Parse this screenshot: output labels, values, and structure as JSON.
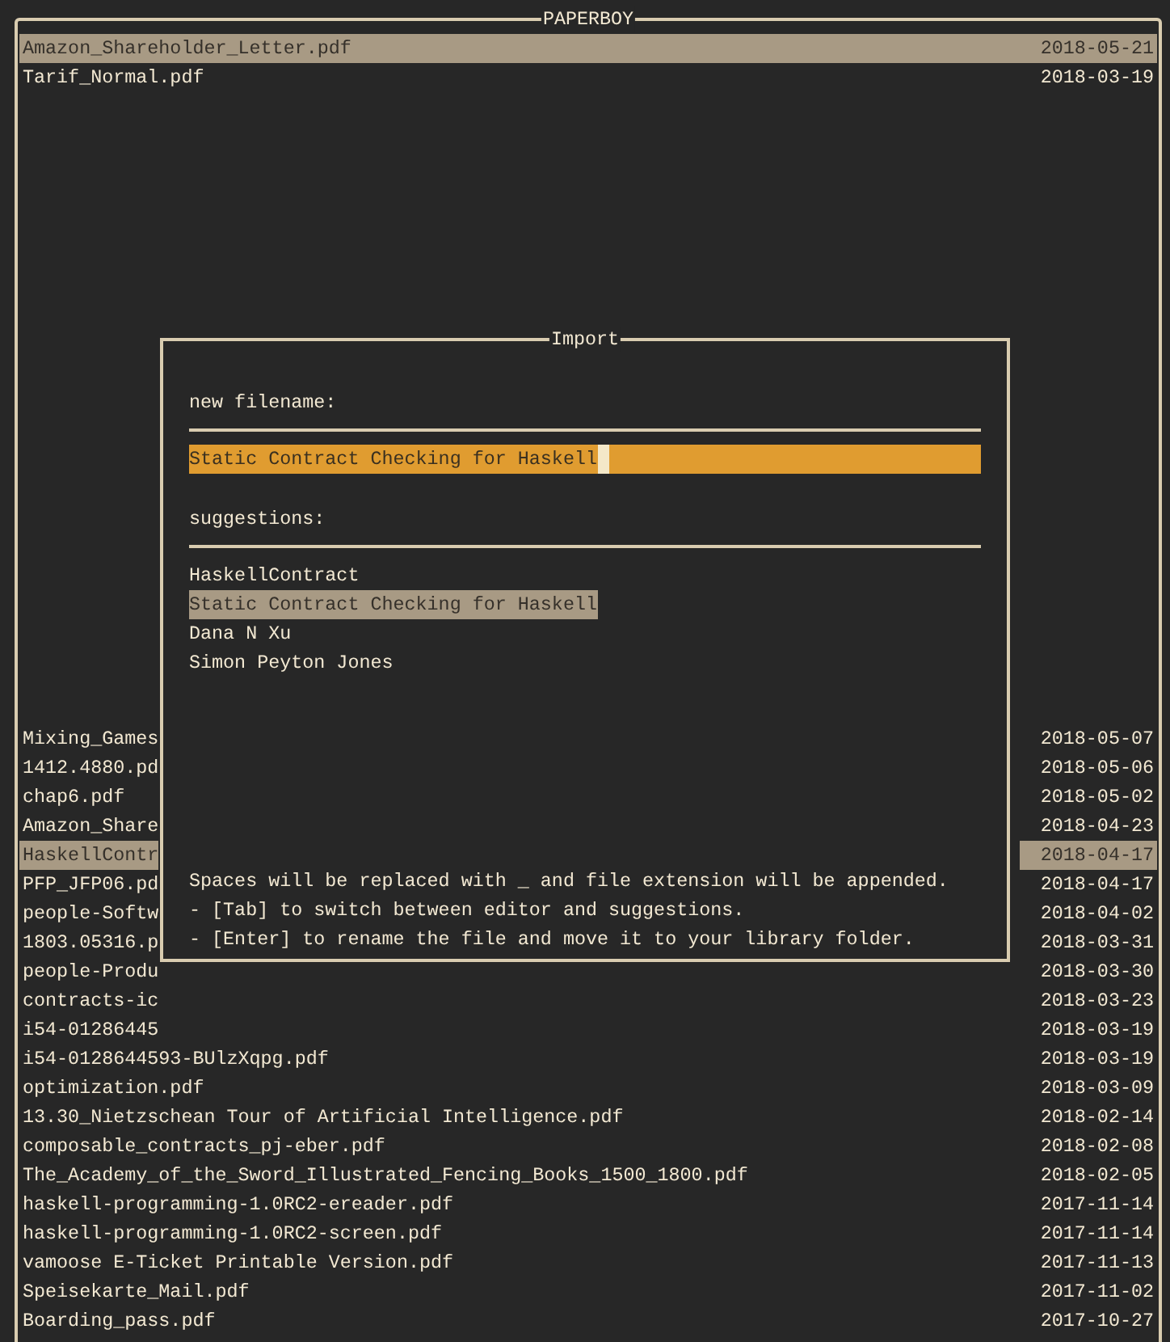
{
  "app": {
    "title": "PAPERBOY"
  },
  "files_top": [
    {
      "name": "Amazon_Shareholder_Letter.pdf",
      "date": "2018-05-21",
      "selected": true
    },
    {
      "name": "Tarif_Normal.pdf",
      "date": "2018-03-19",
      "selected": false
    }
  ],
  "files_bottom": [
    {
      "name": "Mixing_Games",
      "date": "2018-05-07",
      "selected": false
    },
    {
      "name": "1412.4880.pd",
      "date": "2018-05-06",
      "selected": false
    },
    {
      "name": "chap6.pdf",
      "date": "2018-05-02",
      "selected": false
    },
    {
      "name": "Amazon_Share",
      "date": "2018-04-23",
      "selected": false
    },
    {
      "name": "HaskellContr",
      "date": "2018-04-17",
      "selected": true
    },
    {
      "name": "PFP_JFP06.pd",
      "date": "2018-04-17",
      "selected": false
    },
    {
      "name": "people-Softw",
      "date": "2018-04-02",
      "selected": false
    },
    {
      "name": "1803.05316.p",
      "date": "2018-03-31",
      "selected": false
    },
    {
      "name": "people-Produ",
      "date": "2018-03-30",
      "selected": false
    },
    {
      "name": "contracts-ic",
      "date": "2018-03-23",
      "selected": false
    },
    {
      "name": "i54-01286445",
      "date": "2018-03-19",
      "selected": false
    },
    {
      "name": "i54-0128644593-BUlzXqpg.pdf",
      "date": "2018-03-19",
      "selected": false
    },
    {
      "name": "optimization.pdf",
      "date": "2018-03-09",
      "selected": false
    },
    {
      "name": "13.30_Nietzschean Tour of Artificial Intelligence.pdf",
      "date": "2018-02-14",
      "selected": false
    },
    {
      "name": "composable_contracts_pj-eber.pdf",
      "date": "2018-02-08",
      "selected": false
    },
    {
      "name": "The_Academy_of_the_Sword_Illustrated_Fencing_Books_1500_1800.pdf",
      "date": "2018-02-05",
      "selected": false
    },
    {
      "name": "haskell-programming-1.0RC2-ereader.pdf",
      "date": "2017-11-14",
      "selected": false
    },
    {
      "name": "haskell-programming-1.0RC2-screen.pdf",
      "date": "2017-11-14",
      "selected": false
    },
    {
      "name": "vamoose E-Ticket Printable Version.pdf",
      "date": "2017-11-13",
      "selected": false
    },
    {
      "name": "Speisekarte_Mail.pdf",
      "date": "2017-11-02",
      "selected": false
    },
    {
      "name": "Boarding_pass.pdf",
      "date": "2017-10-27",
      "selected": false
    }
  ],
  "import_dialog": {
    "title": "Import",
    "filename_label": "new filename:",
    "filename_field": {
      "value": "Static Contract Checking for Haskell",
      "focused": true
    },
    "suggestions_label": "suggestions:",
    "suggestions": [
      {
        "text": "HaskellContract",
        "selected": false
      },
      {
        "text": "Static Contract Checking for Haskell",
        "selected": true
      },
      {
        "text": "Dana N Xu",
        "selected": false
      },
      {
        "text": "Simon Peyton Jones",
        "selected": false
      }
    ],
    "help": [
      "Spaces will be replaced with _ and file extension will be appended.",
      "- [Tab] to switch between editor and suggestions.",
      "- [Enter] to rename the file and move it to your library folder."
    ]
  }
}
